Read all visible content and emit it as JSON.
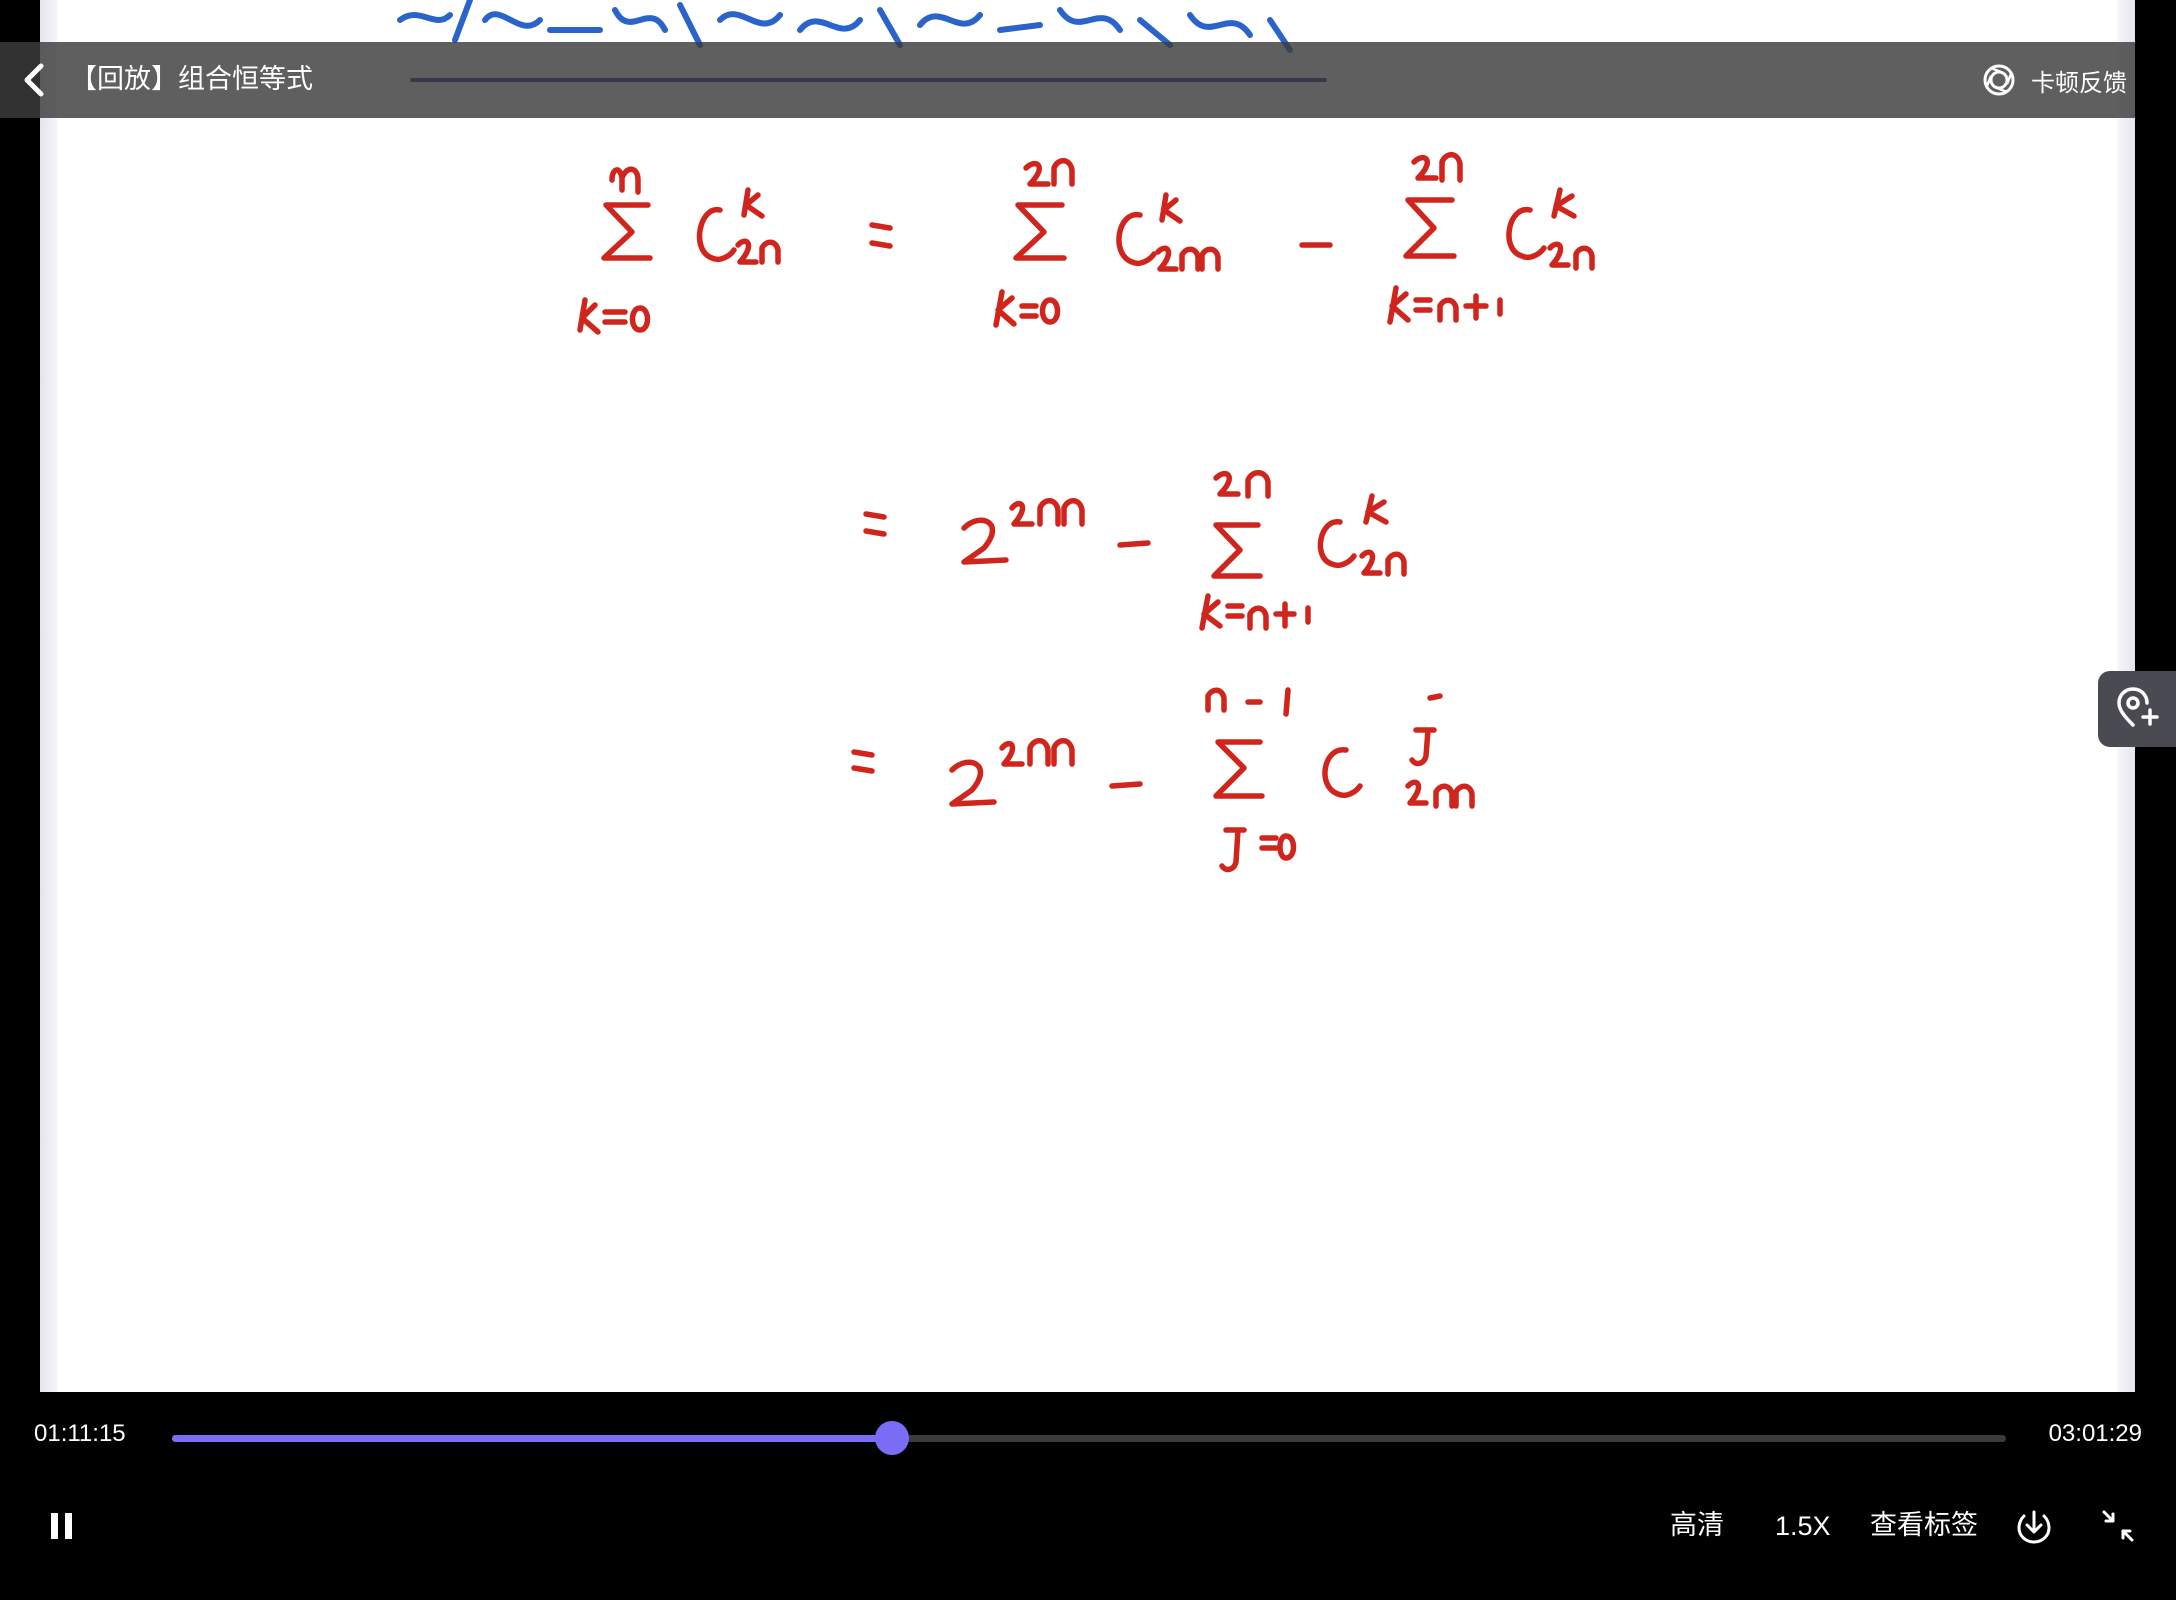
{
  "header": {
    "title": "【回放】组合恒等式",
    "feedback_label": "卡顿反馈"
  },
  "player": {
    "current_time": "01:11:15",
    "total_time": "03:01:29",
    "progress": 0.3925,
    "accent_color": "#7b6cf6"
  },
  "controls": {
    "quality_label": "高清",
    "speed_label": "1.5X",
    "tags_label": "查看标签"
  },
  "icons": {
    "back": "chevron-left-icon",
    "feedback": "camera-lens-icon",
    "side": "pin-add-icon",
    "pause": "pause-icon",
    "download": "download-icon",
    "exit_fullscreen": "exit-fullscreen-icon"
  }
}
